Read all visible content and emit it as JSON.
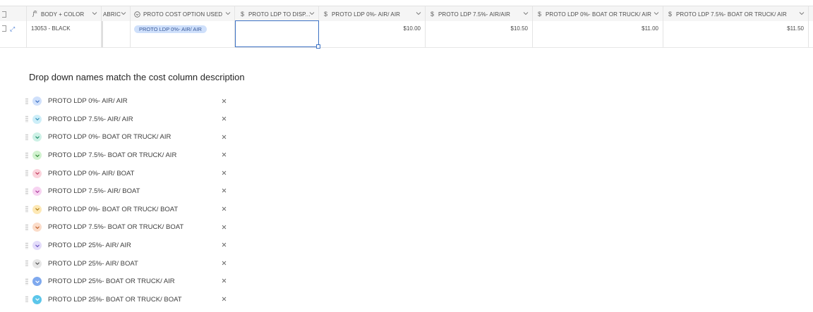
{
  "grid": {
    "columns": [
      {
        "id": "col-body-color",
        "label": "BODY + COLOR",
        "icon": "formula-icon"
      },
      {
        "id": "col-fabric",
        "label": "ABRIC",
        "icon": ""
      },
      {
        "id": "col-proto-cost-option",
        "label": "PROTO COST OPTION USED",
        "icon": "single-select-icon"
      },
      {
        "id": "col-proto-ldp-to-disp",
        "label": "PROTO LDP TO DISP...",
        "icon": "currency-icon"
      },
      {
        "id": "col-ldp0-air-air",
        "label": "PROTO LDP 0%- AIR/ AIR",
        "icon": "currency-icon"
      },
      {
        "id": "col-ldp75-air-air",
        "label": "PROTO LDP 7.5%- AIR/AIR",
        "icon": "currency-icon"
      },
      {
        "id": "col-ldp0-boat-air",
        "label": "PROTO LDP 0%- BOAT OR TRUCK/ AIR",
        "icon": "currency-icon"
      },
      {
        "id": "col-ldp75-boat-air",
        "label": "PROTO LDP 7.5%- BOAT OR TRUCK/ AIR",
        "icon": "currency-icon"
      }
    ],
    "row": {
      "body_color": "13053 - BLACK",
      "cost_option": "PROTO LDP 0%- AIR/ AIR",
      "ldp0_air_air": "$10.00",
      "ldp75_air_air": "$10.50",
      "ldp0_boat_air": "$11.00",
      "ldp75_boat_air": "$11.50"
    }
  },
  "note": "Drop down names match the cost column description",
  "options": [
    {
      "label": "PROTO LDP 0%- AIR/ AIR",
      "color": "#cfe0fb",
      "chevron": "#3b6fc2"
    },
    {
      "label": "PROTO LDP 7.5%- AIR/ AIR",
      "color": "#cdeef8",
      "chevron": "#2f8fb7"
    },
    {
      "label": "PROTO LDP 0%- BOAT OR TRUCK/ AIR",
      "color": "#cdf1e6",
      "chevron": "#1f8f6a"
    },
    {
      "label": "PROTO LDP 7.5%- BOAT OR TRUCK/ AIR",
      "color": "#d1f2cf",
      "chevron": "#2f8a34"
    },
    {
      "label": "PROTO LDP 0%- AIR/ BOAT",
      "color": "#fbd3dc",
      "chevron": "#c23a5c"
    },
    {
      "label": "PROTO LDP 7.5%- AIR/ BOAT",
      "color": "#f7d3f1",
      "chevron": "#b03c9d"
    },
    {
      "label": "PROTO LDP 0%- BOAT OR TRUCK/ BOAT",
      "color": "#fde8b5",
      "chevron": "#b07e10"
    },
    {
      "label": "PROTO LDP 7.5%- BOAT OR TRUCK/ BOAT",
      "color": "#fbdcc9",
      "chevron": "#c0622d"
    },
    {
      "label": "PROTO LDP 25%- AIR/ AIR",
      "color": "#e3dcfa",
      "chevron": "#6a52c2"
    },
    {
      "label": "PROTO LDP 25%- AIR/ BOAT",
      "color": "#e6e6e6",
      "chevron": "#555555"
    },
    {
      "label": "PROTO LDP 25%- BOAT OR TRUCK/ AIR",
      "color": "#7fa9ee",
      "chevron": "#ffffff"
    },
    {
      "label": "PROTO LDP 25%- BOAT OR TRUCK/ BOAT",
      "color": "#5cc6ea",
      "chevron": "#ffffff"
    }
  ]
}
